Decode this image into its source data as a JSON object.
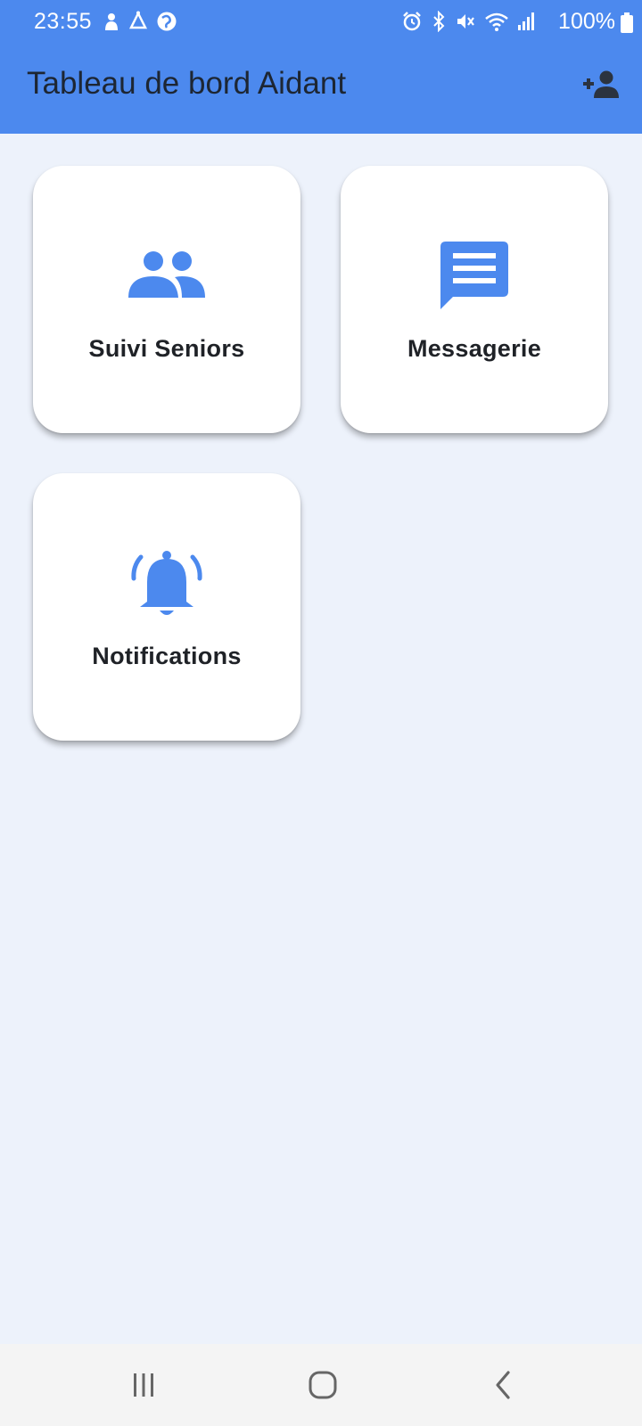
{
  "status_bar": {
    "time": "23:55",
    "battery_text": "100%",
    "left_icons": [
      "notification-app-icon",
      "hourglass-app-icon",
      "browser-app-icon"
    ],
    "right_icons": [
      "alarm-icon",
      "bluetooth-icon",
      "mute-icon",
      "wifi-icon",
      "signal-icon",
      "battery-icon"
    ]
  },
  "header": {
    "title": "Tableau de bord Aidant",
    "action_icon": "person-add-icon"
  },
  "cards": [
    {
      "label": "Suivi Seniors",
      "icon": "people-icon"
    },
    {
      "label": "Messagerie",
      "icon": "message-icon"
    },
    {
      "label": "Notifications",
      "icon": "bell-icon"
    }
  ],
  "nav": {
    "buttons": [
      "recent-apps-icon",
      "home-icon",
      "back-icon"
    ]
  },
  "colors": {
    "primary": "#4c89ee",
    "background": "#edf2fb",
    "card": "#ffffff",
    "title_text": "#1d2633",
    "label_text": "#1f2227",
    "nav_bar": "#f4f4f4",
    "nav_icon": "#666666"
  }
}
